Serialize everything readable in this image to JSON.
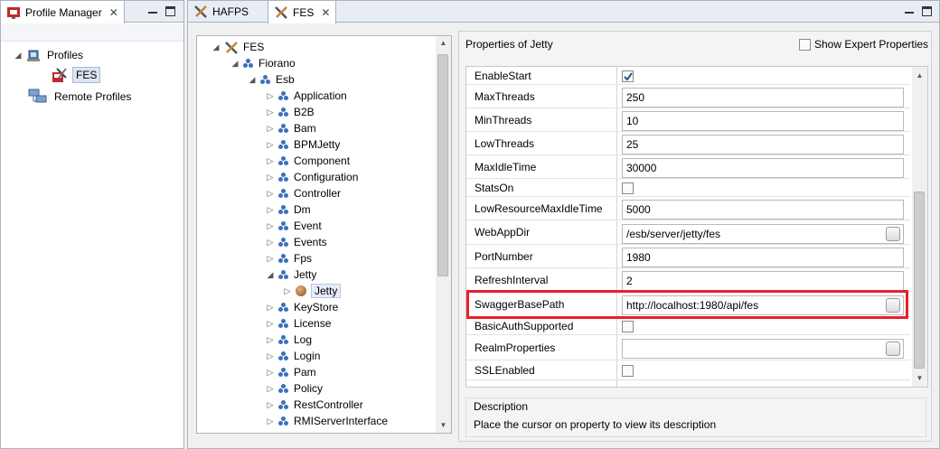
{
  "left_view": {
    "tab_title": "Profile Manager",
    "tree": [
      {
        "label": "Profiles",
        "icon": "profiles-icon",
        "expanded": true
      },
      {
        "label": "FES",
        "icon": "server-tools-icon",
        "selected": true
      },
      {
        "label": "Remote Profiles",
        "icon": "remote-profiles-icon"
      }
    ]
  },
  "editor": {
    "tabs": [
      {
        "label": "HAFPS"
      },
      {
        "label": "FES",
        "active": true
      }
    ],
    "tree": {
      "root": "FES",
      "level1": "Fiorano",
      "level2": "Esb",
      "items": [
        "Application",
        "B2B",
        "Bam",
        "BPMJetty",
        "Component",
        "Configuration",
        "Controller",
        "Dm",
        "Event",
        "Events",
        "Fps",
        "Jetty",
        "KeyStore",
        "License",
        "Log",
        "Login",
        "Pam",
        "Policy",
        "RestController",
        "RMIServerInterface"
      ],
      "jetty_child": "Jetty"
    },
    "properties": {
      "header": "Properties of Jetty",
      "show_expert_label": "Show Expert Properties",
      "rows": [
        {
          "name": "EnableStart",
          "type": "checkbox",
          "checked": true
        },
        {
          "name": "MaxThreads",
          "type": "text",
          "value": "250"
        },
        {
          "name": "MinThreads",
          "type": "text",
          "value": "10"
        },
        {
          "name": "LowThreads",
          "type": "text",
          "value": "25"
        },
        {
          "name": "MaxIdleTime",
          "type": "text",
          "value": "30000"
        },
        {
          "name": "StatsOn",
          "type": "checkbox",
          "checked": false
        },
        {
          "name": "LowResourceMaxIdleTime",
          "type": "text",
          "value": "5000"
        },
        {
          "name": "WebAppDir",
          "type": "text",
          "value": "/esb/server/jetty/fes",
          "button": true
        },
        {
          "name": "PortNumber",
          "type": "text",
          "value": "1980"
        },
        {
          "name": "RefreshInterval",
          "type": "text",
          "value": "2"
        },
        {
          "name": "SwaggerBasePath",
          "type": "text",
          "value": "http://localhost:1980/api/fes",
          "button": true,
          "highlighted": true
        },
        {
          "name": "BasicAuthSupported",
          "type": "checkbox",
          "checked": false
        },
        {
          "name": "RealmProperties",
          "type": "text",
          "value": "",
          "button": true
        },
        {
          "name": "SSLEnabled",
          "type": "checkbox",
          "checked": false
        }
      ],
      "description_title": "Description",
      "description_text": "Place the cursor on property to view its description"
    }
  },
  "colors": {
    "highlight": "#e8202a",
    "tree_node": "#3d6fb8"
  }
}
